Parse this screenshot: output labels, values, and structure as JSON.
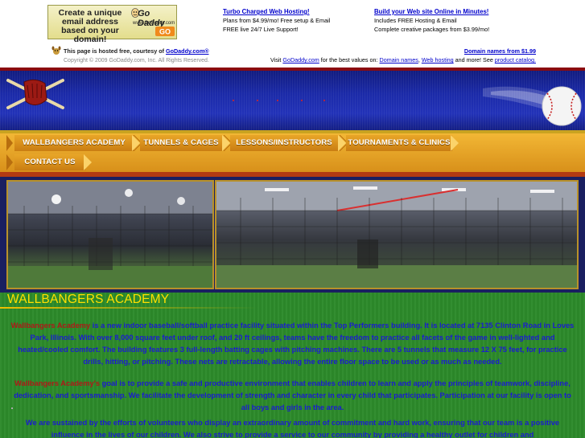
{
  "ad": {
    "banner_text": "Create a unique email address based on your domain!",
    "banner_logo_word": "Go Daddy",
    "banner_logo_url": "www.GoDaddy.com",
    "col1": {
      "link": "Turbo Charged Web Hosting!",
      "line1": "Plans from $4.99/mo! Free setup & Email",
      "line2": "FREE live 24/7 Live Support!"
    },
    "col2": {
      "link": "Build your Web site Online in Minutes!",
      "line1": "Includes FREE Hosting & Email",
      "line2": "Complete creative packages from $3.99/mo!"
    },
    "hosted_prefix": "This page is hosted free, courtesy of ",
    "hosted_link": "GoDaddy.com®",
    "copyright": "Copyright © 2009 GoDaddy.com, Inc. All Rights Reserved.",
    "domain_link": "Domain names from $1.99",
    "promo_prefix": "Visit ",
    "promo_link1": "GoDaddy.com",
    "promo_mid1": " for the best values on: ",
    "promo_link2": "Domain names",
    "promo_mid2": ", ",
    "promo_link3": "Web hosting",
    "promo_mid3": " and more! See ",
    "promo_link4": "product catalog."
  },
  "nav": {
    "row1": [
      "WALLBANGERS ACADEMY",
      "TUNNELS & CAGES",
      "LESSONS/INSTRUCTORS",
      "TOURNAMENTS & CLINICS"
    ],
    "row2": [
      "CONTACT US"
    ]
  },
  "content": {
    "title": "WALLBANGERS ACADEMY",
    "p1_name": "Wallbangers Academy",
    "p1_text": " is a new indoor baseball/softball practice facility situated within the Top Performers building. It is located at 7135 Clinton Road in Loves Park, Illinois. With over 8,000 square feet under roof, and 20 ft ceilings, teams have the freedom to practice all facets of the game in well-lighted and heated/cooled comfort. The building features 3 full-length batting cages with pitching machines. There are 5 tunnels that measure 12 X 75 feet, for practice drills, hitting, or pitching. These nets are retractable, allowing the entire floor space to be used or as much as needed.",
    "p2_name": "Wallbangers Academy's",
    "p2_text": " goal is to provide a safe and productive environment that enables children to learn and apply the principles of teamwork, discipline, dedication, and sportsmanship. We facilitate the development of strength and character in every child that participates. Participation at our facility is open to all boys and girls in the area.",
    "p3_text": "We are sustained by the efforts of volunteers who display an extraordinary amount of commitment and hard work, ensuring that our team is a positive influence in the lives of our children. We also strive to provide a service to our community by providing a healthy outlet for children and"
  },
  "colors": {
    "nav_orange": "#e9a628",
    "content_green": "#2c8a2a",
    "title_yellow": "#ffe000",
    "text_blue": "#1b1bd0",
    "highlight_red": "#b01818",
    "header_blue": "#1b2aa8"
  },
  "icons": [
    "godaddy-logo-icon",
    "godaddy-dog-icon",
    "baseball-glove-icon",
    "baseball-icon"
  ]
}
